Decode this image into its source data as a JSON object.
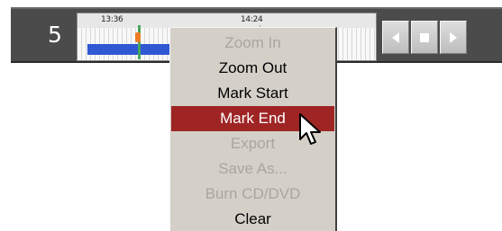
{
  "toolbar": {
    "channel_number": "5",
    "timeline": {
      "time_labels": [
        "13:36",
        "14:24"
      ]
    },
    "controls": [
      {
        "icon": "previous-icon"
      },
      {
        "icon": "stop-icon"
      },
      {
        "icon": "next-icon"
      }
    ]
  },
  "context_menu": {
    "items": [
      {
        "label": "Zoom In",
        "state": "disabled"
      },
      {
        "label": "Zoom Out",
        "state": "enabled"
      },
      {
        "label": "Mark Start",
        "state": "enabled"
      },
      {
        "label": "Mark End",
        "state": "selected"
      },
      {
        "label": "Export",
        "state": "disabled"
      },
      {
        "label": "Save As...",
        "state": "disabled"
      },
      {
        "label": "Burn CD/DVD",
        "state": "disabled"
      },
      {
        "label": "Clear",
        "state": "enabled"
      }
    ]
  },
  "colors": {
    "toolbar_background": "#4b4b4b",
    "recording_bar": "#2f58d2",
    "marker_green": "#46a55d",
    "marker_orange": "#ed7d25",
    "menu_background": "#d4d0c8",
    "menu_highlight": "#9f2525",
    "disabled_text": "#aaa69d"
  }
}
